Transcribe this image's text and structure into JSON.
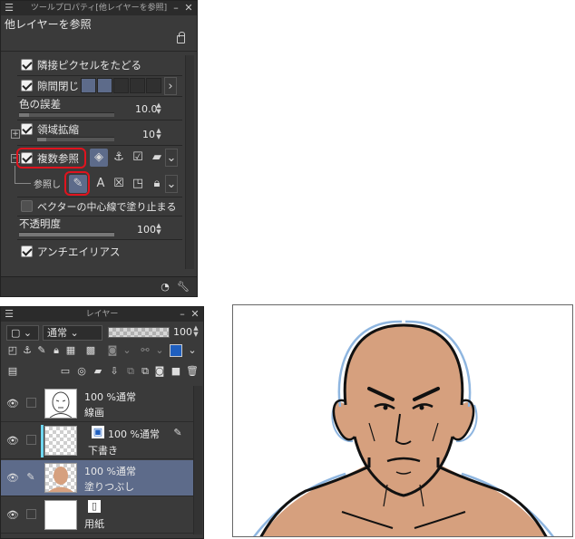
{
  "tool_property": {
    "title": "ツールプロパティ[他レイヤーを参照]",
    "tool_name": "他レイヤーを参照",
    "options": {
      "adjacent_pixels": "隣接ピクセルをたどる",
      "close_gap": "隙間閉じ",
      "color_tolerance": "色の誤差",
      "color_tolerance_value": "10.0",
      "area_scaling": "領域拡縮",
      "area_scaling_value": "10",
      "multi_reference": "複数参照",
      "reference_label": "参照し",
      "stop_at_vector_center": "ベクターの中心線で塗り止まる",
      "opacity": "不透明度",
      "opacity_value": "100",
      "antialias": "アンチエイリアス"
    }
  },
  "layer_panel": {
    "title": "レイヤー",
    "blend_mode": "通常",
    "opacity_value": "100",
    "layers": [
      {
        "mode": "100 %通常",
        "name": "線画"
      },
      {
        "mode": "100 %通常",
        "name": "下書き"
      },
      {
        "mode": "100 %通常",
        "name": "塗りつぶし"
      },
      {
        "mode": "",
        "name": "用紙"
      }
    ]
  },
  "colors": {
    "panel_bg": "#3a3a3a",
    "selected_row": "#5d6b8a",
    "highlight_red": "#e0131e",
    "skin": "#d6a07e",
    "sketch_blue": "#8fb6e0"
  }
}
